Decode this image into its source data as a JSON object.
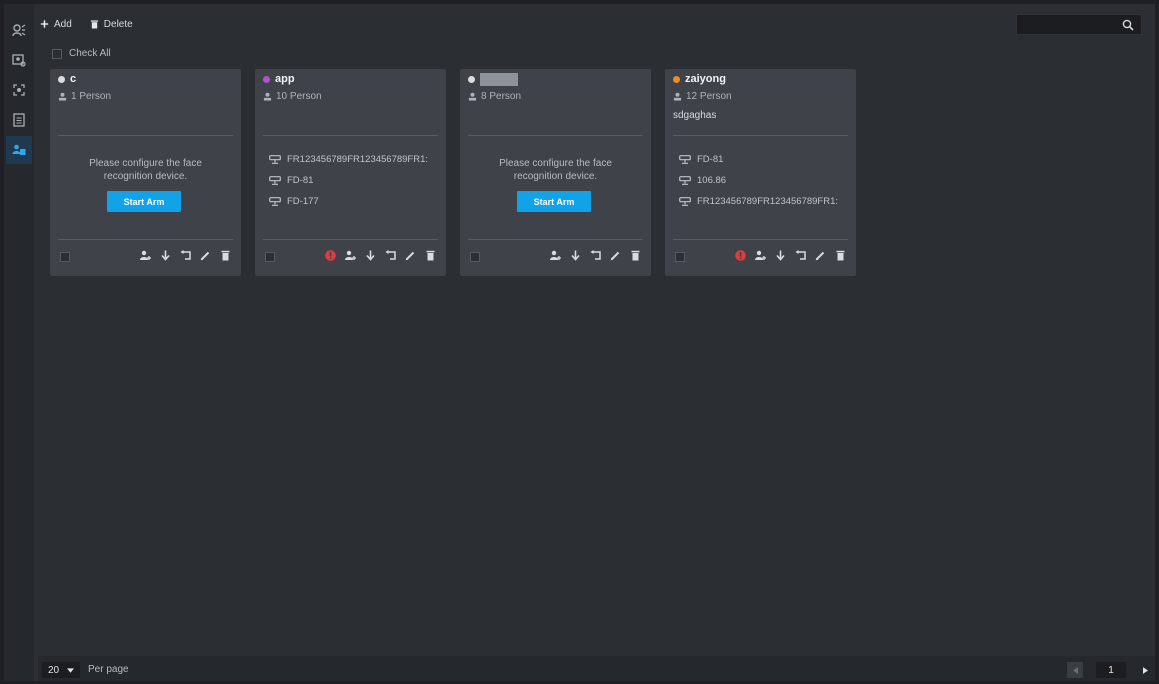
{
  "toolbar": {
    "add_label": "Add",
    "delete_label": "Delete"
  },
  "check_all_label": "Check All",
  "search": {
    "placeholder": ""
  },
  "colors": {
    "accent": "#12a2e8",
    "card_bg": "#3f4349",
    "warn": "#e23b3b"
  },
  "cards": [
    {
      "name": "c",
      "dot_color": "#dcdcdc",
      "persons": "1 Person",
      "desc": "",
      "msg": [
        "Please configure the face",
        "recognition device."
      ],
      "button": "Start Arm",
      "devices": [],
      "warning": false
    },
    {
      "name": "app",
      "dot_color": "#b24fd9",
      "persons": "10 Person",
      "desc": "",
      "msg": [],
      "button": "",
      "devices": [
        "FR123456789FR123456789FR1:",
        "FD-81",
        "FD-177"
      ],
      "warning": true
    },
    {
      "name": "",
      "dot_color": "#dcdcdc",
      "persons": "8 Person",
      "desc": "",
      "msg": [
        "Please configure the face",
        "recognition device."
      ],
      "button": "Start Arm",
      "devices": [],
      "warning": false
    },
    {
      "name": "zaiyong",
      "dot_color": "#f08a24",
      "persons": "12 Person",
      "desc": "sdgaghas",
      "msg": [],
      "button": "",
      "devices": [
        "FD-81",
        "106.86",
        "FR123456789FR123456789FR1:"
      ],
      "warning": true
    }
  ],
  "footer": {
    "per_page_value": "20",
    "per_page_label": "Per page",
    "page": "1"
  }
}
